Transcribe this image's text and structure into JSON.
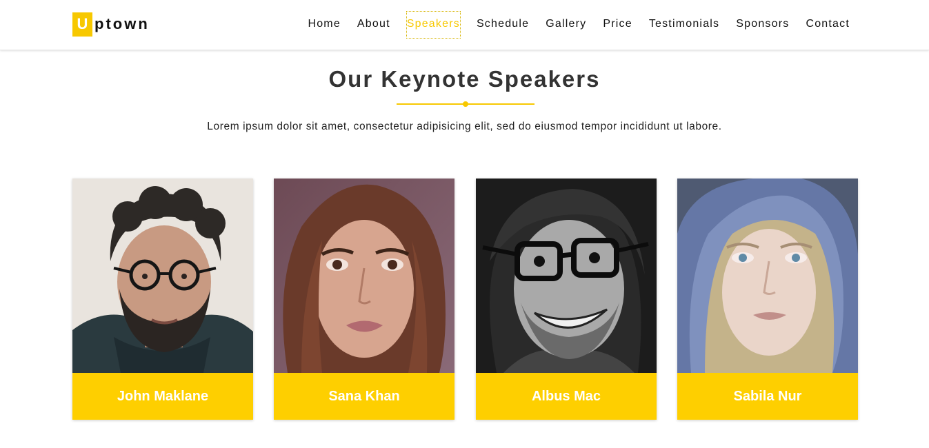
{
  "header": {
    "logo_letter": "U",
    "logo_text": "ptown",
    "nav": [
      "Home",
      "About",
      "Speakers",
      "Schedule",
      "Gallery",
      "Price",
      "Testimonials",
      "Sponsors",
      "Contact"
    ],
    "active_nav": "Speakers"
  },
  "section": {
    "title": "Our Keynote Speakers",
    "description": "Lorem ipsum dolor sit amet, consectetur adipisicing elit, sed do eiusmod tempor incididunt ut labore."
  },
  "speakers": [
    {
      "name": "John Maklane"
    },
    {
      "name": "Sana Khan"
    },
    {
      "name": "Albus Mac"
    },
    {
      "name": "Sabila Nur"
    }
  ],
  "colors": {
    "accent": "#fecf00",
    "text_dark": "#333333",
    "nav_text": "#111111"
  }
}
